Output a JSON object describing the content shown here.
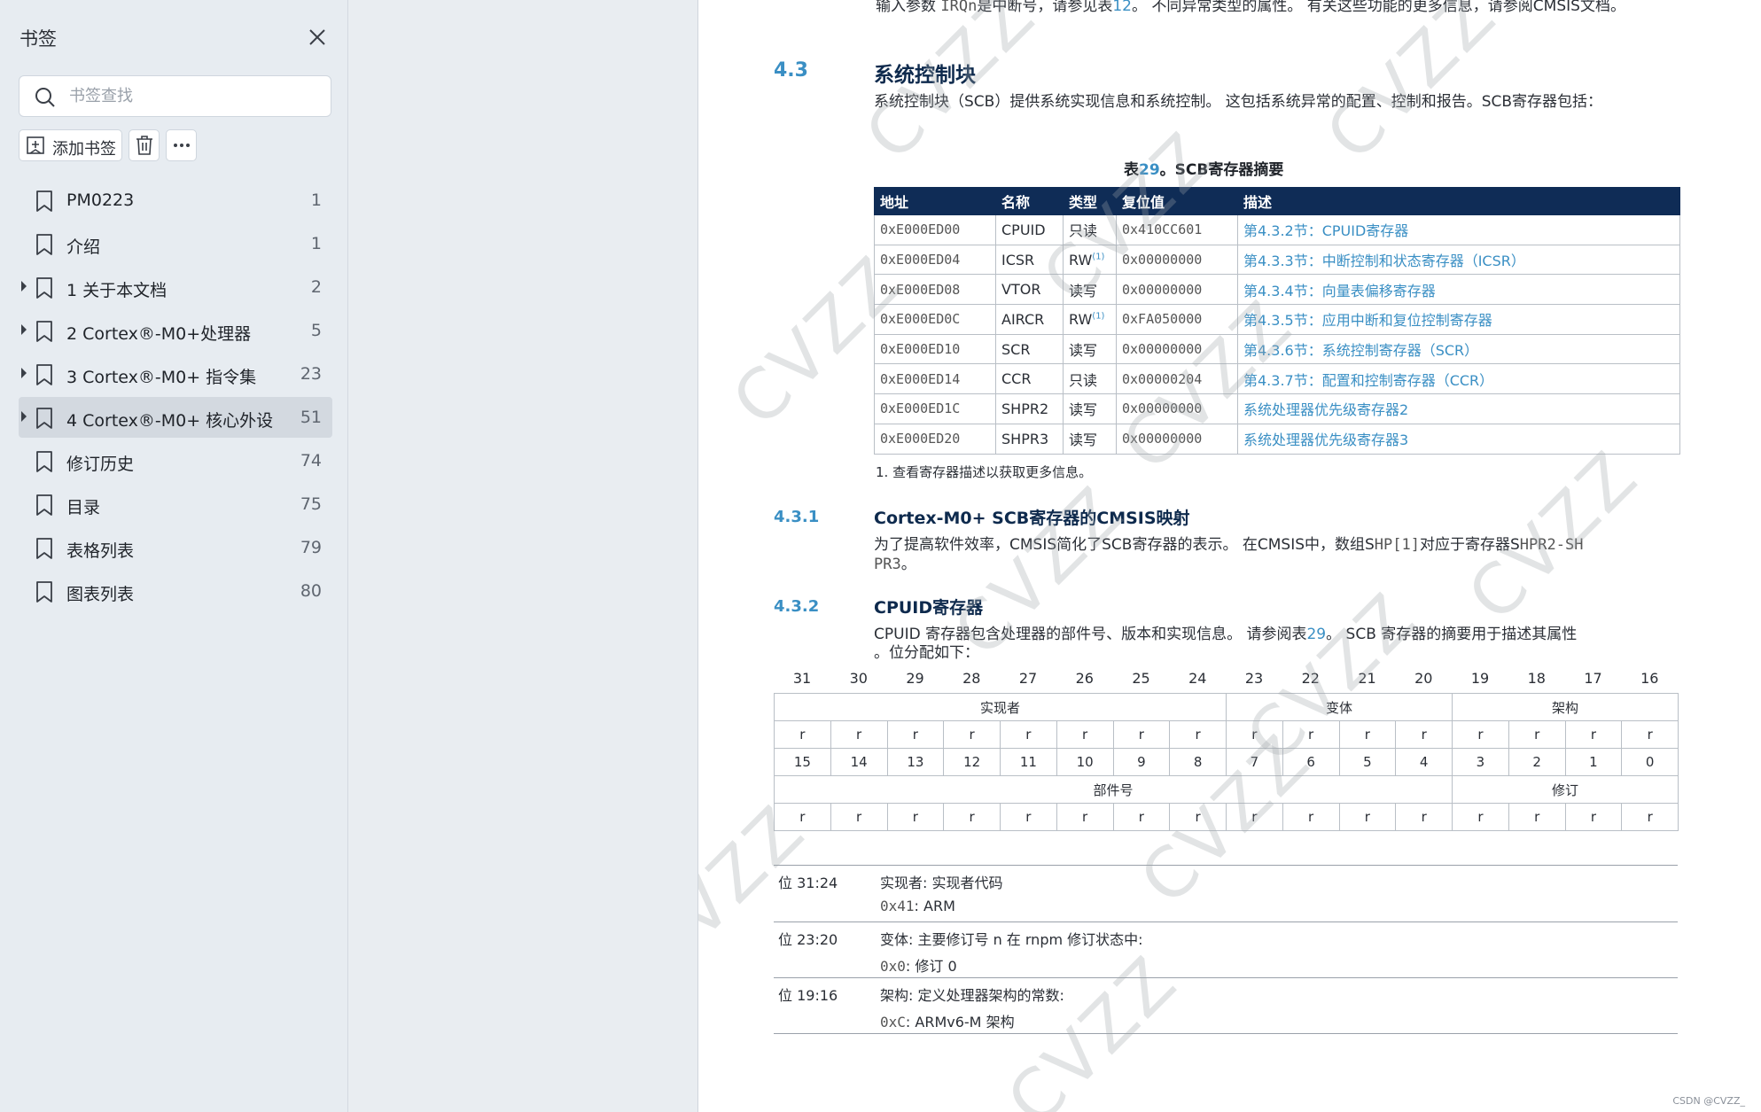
{
  "sidebar": {
    "title": "书签",
    "search_placeholder": "书签查找",
    "add_label": "添加书签",
    "items": [
      {
        "label": "PM0223",
        "page": "1",
        "expandable": false,
        "active": false
      },
      {
        "label": "介绍",
        "page": "1",
        "expandable": false,
        "active": false
      },
      {
        "label": "1 关于本文档",
        "page": "2",
        "expandable": true,
        "active": false
      },
      {
        "label": "2 Cortex®-M0+处理器",
        "page": "5",
        "expandable": true,
        "active": false
      },
      {
        "label": "3 Cortex®-M0+ 指令集",
        "page": "23",
        "expandable": true,
        "active": false
      },
      {
        "label": "4 Cortex®-M0+ 核心外设",
        "page": "51",
        "expandable": true,
        "active": true
      },
      {
        "label": "修订历史",
        "page": "74",
        "expandable": false,
        "active": false
      },
      {
        "label": "目录",
        "page": "75",
        "expandable": false,
        "active": false
      },
      {
        "label": "表格列表",
        "page": "79",
        "expandable": false,
        "active": false
      },
      {
        "label": "图表列表",
        "page": "80",
        "expandable": false,
        "active": false
      }
    ]
  },
  "doc": {
    "top_line_a": "输入参数 ",
    "top_line_code": "IRQn",
    "top_line_b": "是中断号，请参见表",
    "top_line_ref": "12",
    "top_line_c": "。 不同异常类型的属性。 有关这些功能的更多信息，请参阅CMSIS文档。",
    "sec43_num": "4.3",
    "sec43_title": "系统控制块",
    "sec43_body": "系统控制块（SCB）提供系统实现信息和系统控制。 这包括系统异常的配置、控制和报告。SCB寄存器包括：",
    "table_caption_pre": "表",
    "table_caption_num": "29",
    "table_caption_post": "。SCB寄存器摘要",
    "table_headers": [
      "地址",
      "名称",
      "类型",
      "复位值",
      "描述"
    ],
    "table_rows": [
      {
        "addr": "0xE000ED00",
        "name": "CPUID",
        "type": "只读",
        "type_sup": "",
        "reset": "0x410CC601",
        "desc": "第4.3.2节：CPUID寄存器"
      },
      {
        "addr": "0xE000ED04",
        "name": "ICSR",
        "type": "RW",
        "type_sup": "(1)",
        "reset": "0x00000000",
        "desc": "第4.3.3节：中断控制和状态寄存器（ICSR）"
      },
      {
        "addr": "0xE000ED08",
        "name": "VTOR",
        "type": "读写",
        "type_sup": "",
        "reset": "0x00000000",
        "desc": "第4.3.4节：向量表偏移寄存器"
      },
      {
        "addr": "0xE000ED0C",
        "name": "AIRCR",
        "type": "RW",
        "type_sup": "(1)",
        "reset": "0xFA050000",
        "desc": "第4.3.5节：应用中断和复位控制寄存器"
      },
      {
        "addr": "0xE000ED10",
        "name": "SCR",
        "type": "读写",
        "type_sup": "",
        "reset": "0x00000000",
        "desc": "第4.3.6节：系统控制寄存器（SCR）"
      },
      {
        "addr": "0xE000ED14",
        "name": "CCR",
        "type": "只读",
        "type_sup": "",
        "reset": "0x00000204",
        "desc": "第4.3.7节：配置和控制寄存器（CCR）"
      },
      {
        "addr": "0xE000ED1C",
        "name": "SHPR2",
        "type": "读写",
        "type_sup": "",
        "reset": "0x00000000",
        "desc": "系统处理器优先级寄存器2"
      },
      {
        "addr": "0xE000ED20",
        "name": "SHPR3",
        "type": "读写",
        "type_sup": "",
        "reset": "0x00000000",
        "desc": "系统处理器优先级寄存器3"
      }
    ],
    "table_footnote": "1. 查看寄存器描述以获取更多信息。",
    "sec431_num": "4.3.1",
    "sec431_title": "Cortex-M0+ SCB寄存器的CMSIS映射",
    "sec431_body1_a": "为了提高软件效率，CMSIS简化了SCB寄存器的表示。 在CMSIS中，数组S",
    "sec431_body1_code": "HP[1]",
    "sec431_body1_b": "对应于寄存器S",
    "sec431_body1_code2": "HPR2-SH",
    "sec431_body2_code": "PR3",
    "sec431_body2_b": "。",
    "sec432_num": "4.3.2",
    "sec432_title": "CPUID寄存器",
    "sec432_body1_a": "CPUID 寄存器包含处理器的部件号、版本和实现信息。 请参阅表",
    "sec432_body1_ref": "29",
    "sec432_body1_b": "。 SCB 寄存器的摘要用于描述其属性",
    "sec432_body2": "。位分配如下：",
    "bits_high": [
      "31",
      "30",
      "29",
      "28",
      "27",
      "26",
      "25",
      "24",
      "23",
      "22",
      "21",
      "20",
      "19",
      "18",
      "17",
      "16"
    ],
    "bits_low": [
      "15",
      "14",
      "13",
      "12",
      "11",
      "10",
      "9",
      "8",
      "7",
      "6",
      "5",
      "4",
      "3",
      "2",
      "1",
      "0"
    ],
    "field_implementer": "实现者",
    "field_variant": "变体",
    "field_arch": "架构",
    "field_partno": "部件号",
    "field_revision": "修订",
    "access": "r",
    "desc_rows": [
      {
        "bits": "位 31:24",
        "text": "实现者: 实现者代码",
        "val_code": "0x41",
        "val_text": ": ARM"
      },
      {
        "bits": "位 23:20",
        "text": "变体: 主要修订号 n 在 rnpm 修订状态中:",
        "val_code": "0x0",
        "val_text": ": 修订 0"
      },
      {
        "bits": "位 19:16",
        "text": "架构: 定义处理器架构的常数:",
        "val_code": "0xC",
        "val_text": ": ARMv6-M 架构"
      }
    ],
    "watermark": "CVZZ",
    "footer": "CSDN @CVZZ_"
  },
  "colors": {
    "accent_blue": "#3a8fc4",
    "table_header": "#0f2c56",
    "sidebar_bg": "#e7ecf1"
  }
}
